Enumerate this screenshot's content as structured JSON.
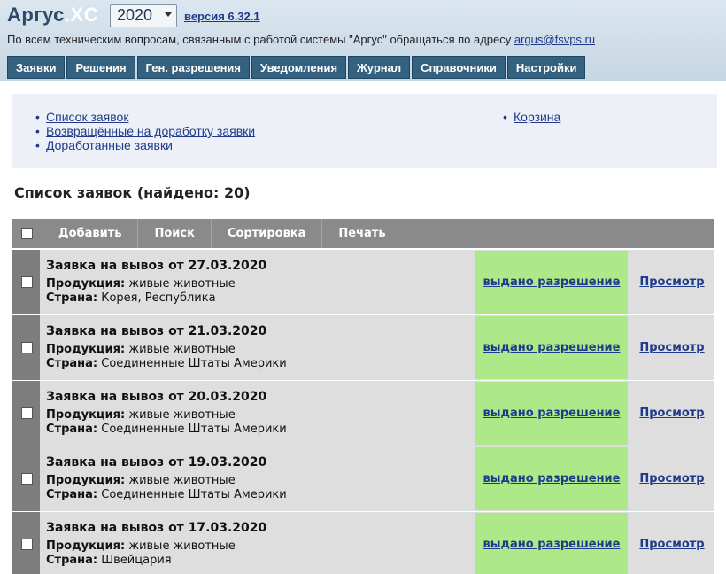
{
  "header": {
    "logo_main": "Аргус",
    "logo_dot": ".",
    "logo_suffix": "XC",
    "year_value": "2020",
    "version_link": "версия 6.32.1",
    "support_text": "По всем техническим вопросам, связанным с работой системы \"Аргус\" обращаться по адресу ",
    "support_email": "argus@fsvps.ru"
  },
  "nav": {
    "tabs": [
      "Заявки",
      "Решения",
      "Ген. разрешения",
      "Уведомления",
      "Журнал",
      "Справочники",
      "Настройки"
    ]
  },
  "submenu": {
    "left": [
      "Список заявок",
      "Возвращённые на доработку заявки",
      "Доработанные заявки"
    ],
    "right": [
      "Корзина"
    ]
  },
  "list": {
    "title": "Список заявок (найдено: 20)"
  },
  "toolbar": {
    "add": "Добавить",
    "search": "Поиск",
    "sort": "Сортировка",
    "print": "Печать"
  },
  "labels": {
    "product": "Продукция:",
    "country": "Страна:"
  },
  "rows": [
    {
      "title": "Заявка на вывоз от 27.03.2020",
      "product": "живые животные",
      "country": "Корея, Республика",
      "status": "выдано разрешение",
      "view": "Просмотр"
    },
    {
      "title": "Заявка на вывоз от 21.03.2020",
      "product": "живые животные",
      "country": "Соединенные Штаты Америки",
      "status": "выдано разрешение",
      "view": "Просмотр"
    },
    {
      "title": "Заявка на вывоз от 20.03.2020",
      "product": "живые животные",
      "country": "Соединенные Штаты Америки",
      "status": "выдано разрешение",
      "view": "Просмотр"
    },
    {
      "title": "Заявка на вывоз от 19.03.2020",
      "product": "живые животные",
      "country": "Соединенные Штаты Америки",
      "status": "выдано разрешение",
      "view": "Просмотр"
    },
    {
      "title": "Заявка на вывоз от 17.03.2020",
      "product": "живые животные",
      "country": "Швейцария",
      "status": "выдано разрешение",
      "view": "Просмотр"
    }
  ],
  "colors": {
    "header_bg": "#c6d6e3",
    "nav_tab_bg": "#33617f",
    "toolbar_bg": "#8a8a8a",
    "status_green": "#ade989",
    "link_blue": "#1f3a8a"
  }
}
